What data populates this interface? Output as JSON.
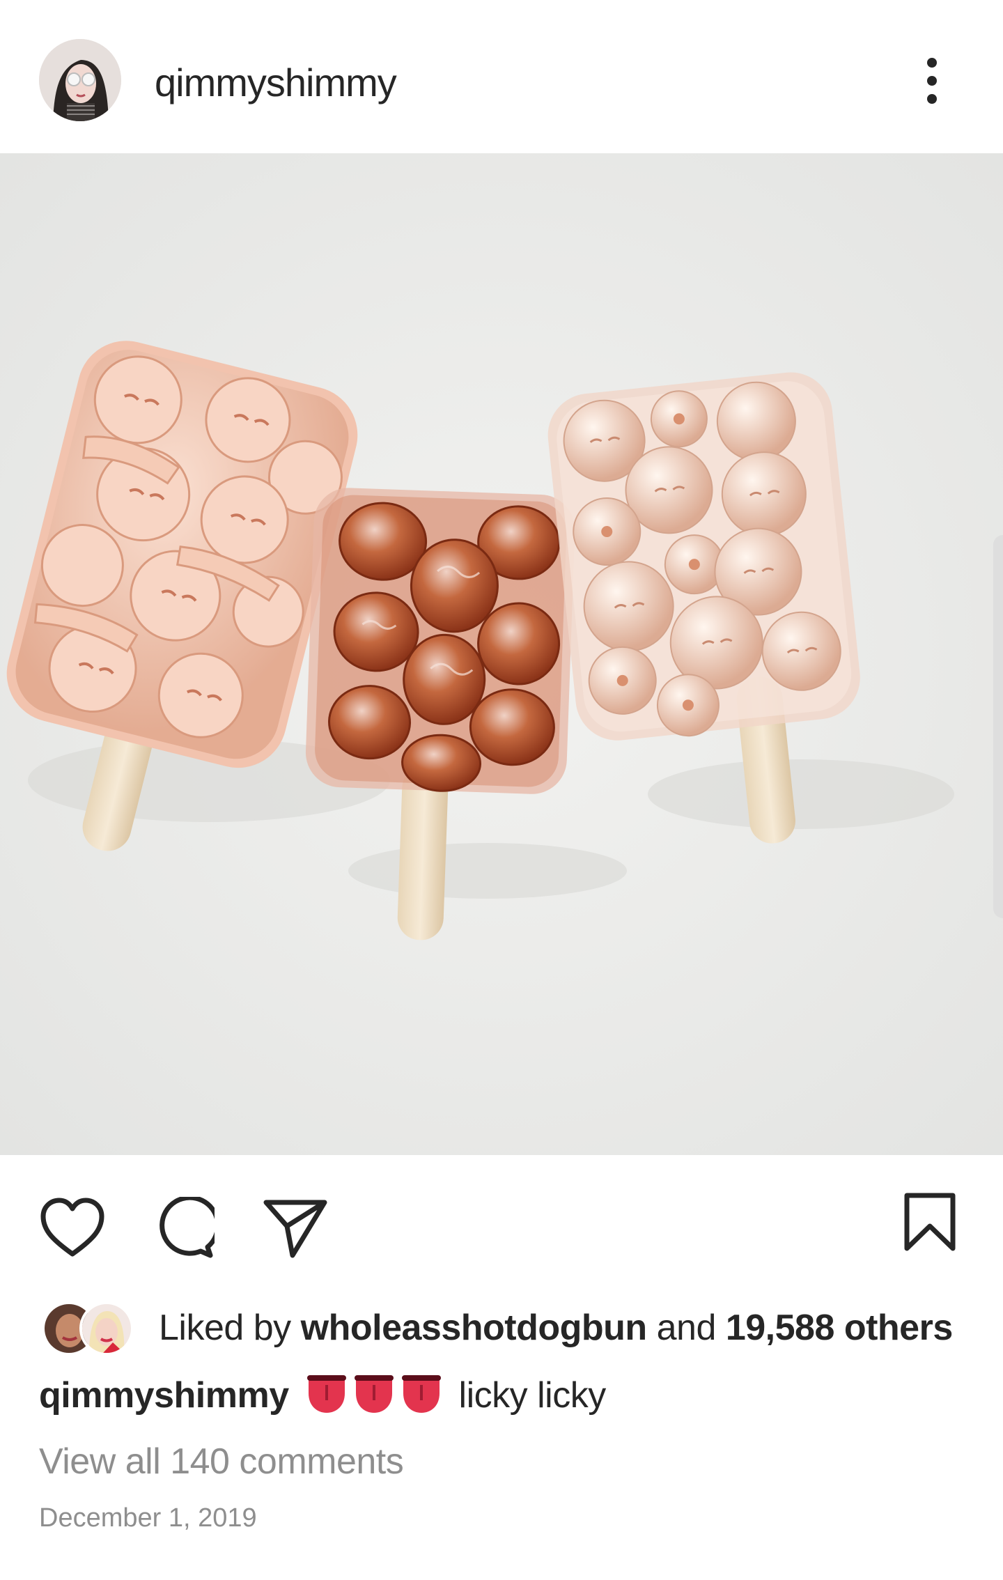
{
  "post": {
    "username": "qimmyshimmy",
    "more_icon": "more-vertical-icon"
  },
  "photo": {
    "icon": "photo-image"
  },
  "actions": {
    "like_icon": "heart-icon",
    "comment_icon": "comment-icon",
    "share_icon": "send-icon",
    "save_icon": "bookmark-icon"
  },
  "likes": {
    "prefix": "Liked by",
    "liked_by": "wholeasshotdogbun",
    "conjunction": "and",
    "others": "19,588 others"
  },
  "caption": {
    "username": "qimmyshimmy",
    "emoji": "👅👅👅",
    "text": "licky licky"
  },
  "comments": {
    "view_all": "View all 140 comments"
  },
  "date": "December 1, 2019",
  "colors": {
    "text": "#262626",
    "muted": "#8e8e8e",
    "background": "#ffffff"
  }
}
